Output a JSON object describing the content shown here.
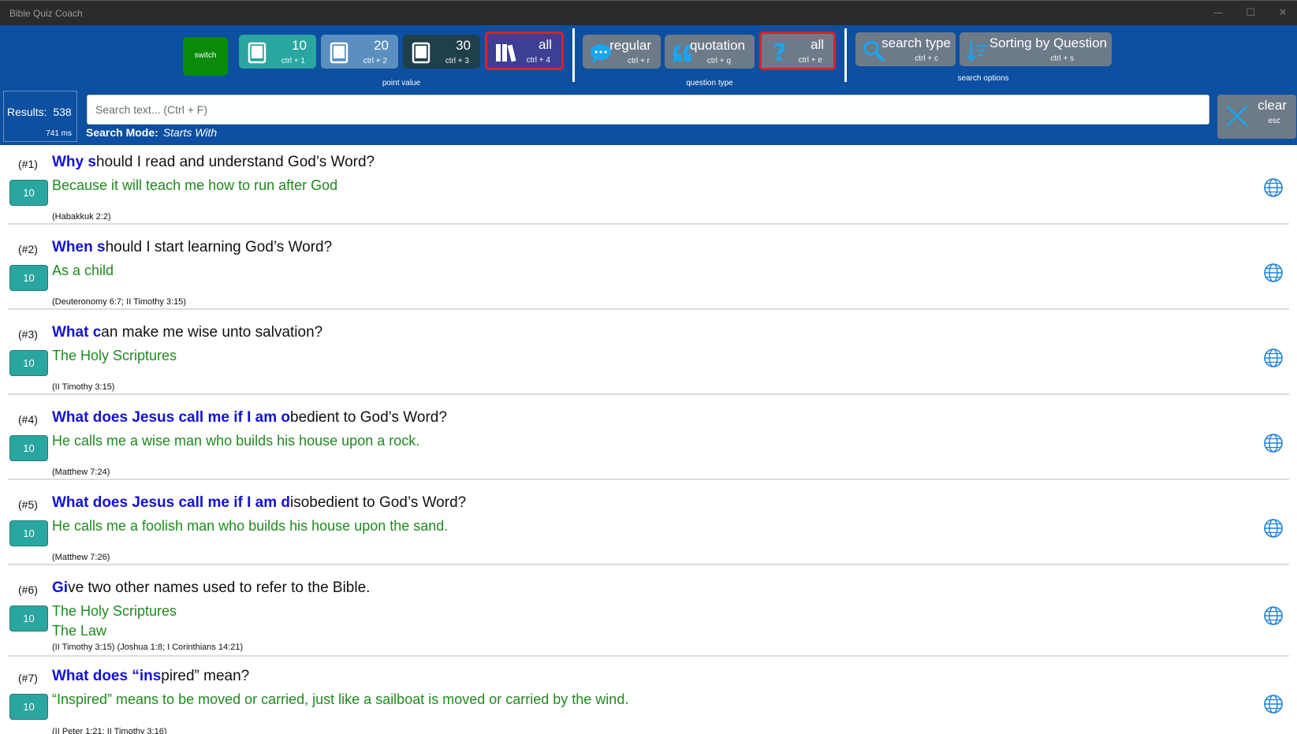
{
  "window": {
    "title": "Bible Quiz Coach",
    "minimize": "—",
    "maximize": "☐",
    "close": "✕"
  },
  "toolbar": {
    "switch_label": "switch",
    "point_value": {
      "caption": "point value",
      "buttons": [
        {
          "label": "10",
          "shortcut": "ctrl + 1"
        },
        {
          "label": "20",
          "shortcut": "ctrl + 2"
        },
        {
          "label": "30",
          "shortcut": "ctrl + 3"
        },
        {
          "label": "all",
          "shortcut": "ctrl + 4"
        }
      ]
    },
    "question_type": {
      "caption": "question type",
      "buttons": [
        {
          "label": "regular",
          "shortcut": "ctrl + r"
        },
        {
          "label": "quotation",
          "shortcut": "ctrl + q"
        },
        {
          "label": "all",
          "shortcut": "ctrl + e"
        }
      ]
    },
    "search_options": {
      "caption": "search options",
      "buttons": [
        {
          "label": "search type",
          "shortcut": "ctrl + c"
        },
        {
          "label": "Sorting by Question",
          "shortcut": "ctrl + s"
        }
      ]
    }
  },
  "results": {
    "label": "Results:",
    "count": "538",
    "time": "741 ms"
  },
  "search": {
    "placeholder": "Search text... (Ctrl + F)",
    "mode_label": "Search Mode:",
    "mode_value": "Starts With"
  },
  "clear": {
    "label": "clear",
    "shortcut": "esc"
  },
  "colors": {
    "toolbar": "#0d4fa0",
    "highlight": "#1212d6",
    "answer": "#1e8a1e",
    "points": "#2aa6a0",
    "selected_border": "#d8232a"
  },
  "items": [
    {
      "num": "(#1)",
      "points": "10",
      "q_hl": "Why s",
      "q_rest": "hould I read and understand God’s Word?",
      "answers": [
        "Because it will teach me how to run after God"
      ],
      "ref": "(Habakkuk 2:2)"
    },
    {
      "num": "(#2)",
      "points": "10",
      "q_hl": "When s",
      "q_rest": "hould I start learning God’s Word?",
      "answers": [
        "As a child"
      ],
      "ref": "(Deuteronomy 6:7; II Timothy 3:15)"
    },
    {
      "num": "(#3)",
      "points": "10",
      "q_hl": "What c",
      "q_rest": "an make me wise unto salvation?",
      "answers": [
        "The Holy Scriptures"
      ],
      "ref": "(II Timothy 3:15)"
    },
    {
      "num": "(#4)",
      "points": "10",
      "q_hl": "What does Jesus call me if I am o",
      "q_rest": "bedient to God’s Word?",
      "answers": [
        "He calls me a wise man who builds his house upon a rock."
      ],
      "ref": "(Matthew 7:24)"
    },
    {
      "num": "(#5)",
      "points": "10",
      "q_hl": "What does Jesus call me if I am d",
      "q_rest": "isobedient to God’s Word?",
      "answers": [
        "He calls me a foolish man who builds his house upon the sand."
      ],
      "ref": "(Matthew 7:26)"
    },
    {
      "num": "(#6)",
      "points": "10",
      "q_hl": "Gi",
      "q_rest": "ve two other names used to refer to the Bible.",
      "answers": [
        "The Holy Scriptures",
        "The Law"
      ],
      "ref": "(II Timothy 3:15) (Joshua 1:8; I Corinthians 14:21)"
    },
    {
      "num": "(#7)",
      "points": "10",
      "q_hl": "What does “ins",
      "q_rest": "pired” mean?",
      "answers": [
        "“Inspired” means to be moved or carried, just like a sailboat is moved or carried by the wind."
      ],
      "ref": "(II Peter 1:21; II Timothy 3:16)"
    }
  ]
}
